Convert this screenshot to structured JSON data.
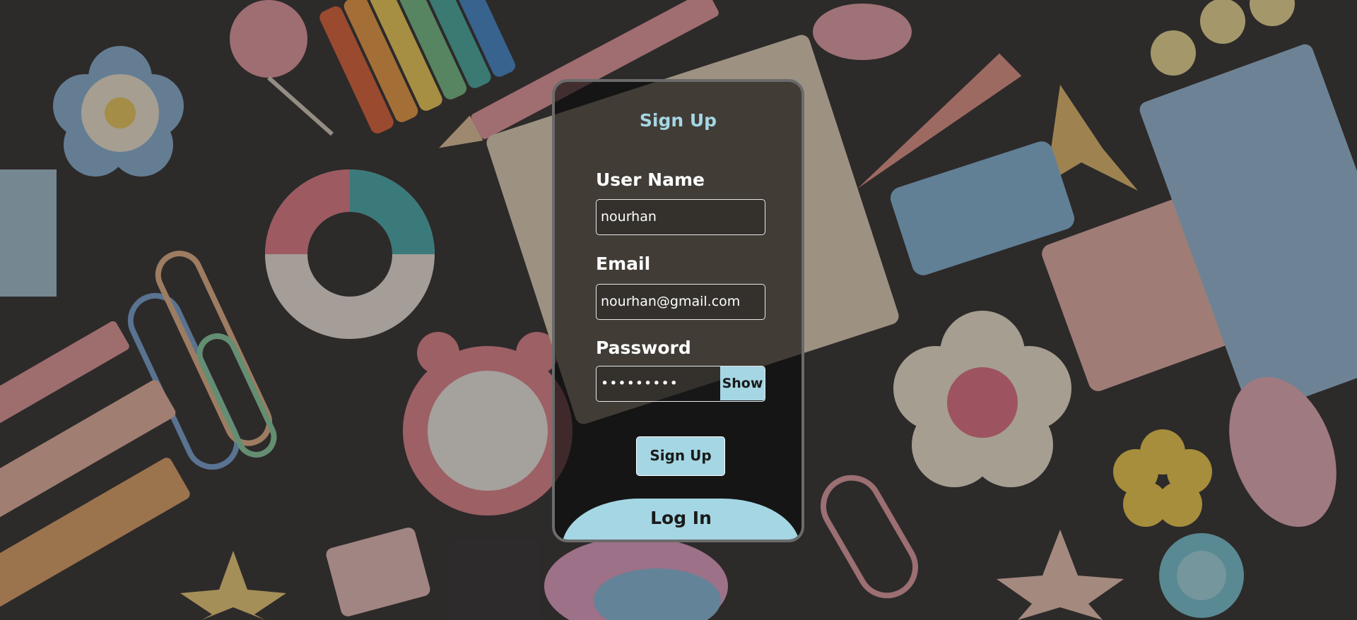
{
  "form": {
    "title": "Sign Up",
    "username_label": "User Name",
    "username_value": "nourhan",
    "email_label": "Email",
    "email_value": "nourhan@gmail.com",
    "password_label": "Password",
    "password_masked": "•••••••••",
    "show_label": "Show",
    "signup_label": "Sign Up",
    "login_label": "Log In"
  },
  "colors": {
    "accent": "#a5d6e3",
    "background": "#3b3838",
    "card": "#080808"
  },
  "icons": [
    "stationery-background-image"
  ]
}
